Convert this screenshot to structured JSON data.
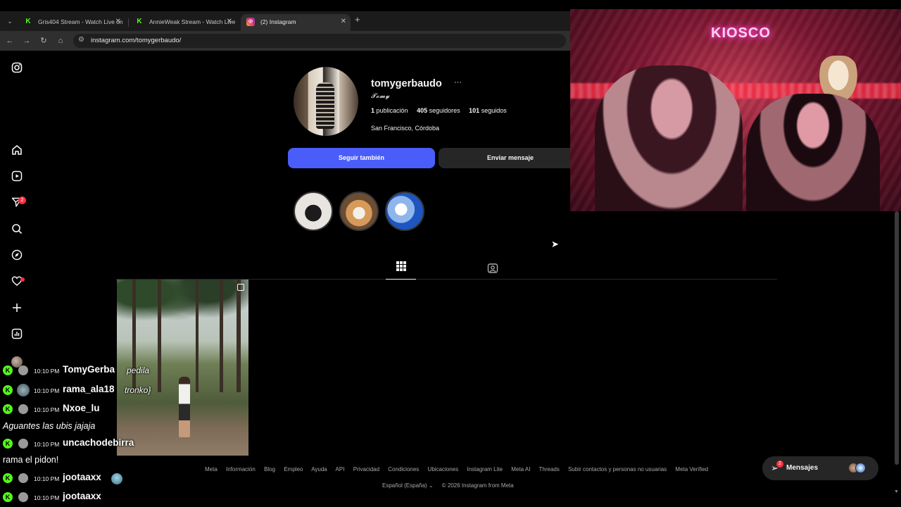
{
  "browser": {
    "tabs": [
      {
        "label": "Gris404 Stream - Watch Live on",
        "favicon": "kick-icon",
        "active": false
      },
      {
        "label": "AnnieWeak Stream - Watch Live",
        "favicon": "kick-icon",
        "active": false
      },
      {
        "label": "(2) Instagram",
        "favicon": "instagram-icon",
        "active": true
      }
    ],
    "new_tab": "+",
    "url": "instagram.com/tomygerbaudo/"
  },
  "sidebar": {
    "notifications_badge": "2"
  },
  "profile": {
    "username": "tomygerbaudo",
    "more": "···",
    "full_name": "𝓣𝓸𝓶𝔂",
    "stats": {
      "posts_count": "1",
      "posts_label": "publicación",
      "followers_count": "405",
      "followers_label": "seguidores",
      "following_count": "101",
      "following_label": "seguidos"
    },
    "location": "San Francisco, Córdoba",
    "follow_button": "Seguir también",
    "message_button": "Enviar mensaje"
  },
  "footer": {
    "links": [
      "Meta",
      "Información",
      "Blog",
      "Empleo",
      "Ayuda",
      "API",
      "Privacidad",
      "Condiciones",
      "Ubicaciones",
      "Instagram Lite",
      "Meta AI",
      "Threads",
      "Subir contactos y personas no usuarias",
      "Meta Verified"
    ],
    "language": "Español (España)",
    "copyright": "© 2026 Instagram from Meta"
  },
  "messages": {
    "label": "Mensajes",
    "badge": "2"
  },
  "webcam": {
    "neon_sign": "KIOSCO"
  },
  "chat": {
    "lines": [
      {
        "time": "10:10 PM",
        "user": "TomyGerba",
        "message": "pedila"
      },
      {
        "time": "10:10 PM",
        "user": "rama_ala18",
        "message": "tronko}"
      },
      {
        "time": "10:10 PM",
        "user": "Nxoe_lu",
        "message": ""
      },
      {
        "text": "Aguantes las ubis jajaja"
      },
      {
        "time": "10:10 PM",
        "user": "uncachodebirra",
        "message": ""
      },
      {
        "text": "rama el pidon!"
      },
      {
        "time": "10:10 PM",
        "user": "jootaaxx",
        "message": ""
      },
      {
        "time": "10:10 PM",
        "user": "jootaaxx",
        "message": ""
      }
    ]
  },
  "colors": {
    "follow_button": "#4a5df9",
    "badge": "#ff3040",
    "kick_green": "#53fc18"
  }
}
